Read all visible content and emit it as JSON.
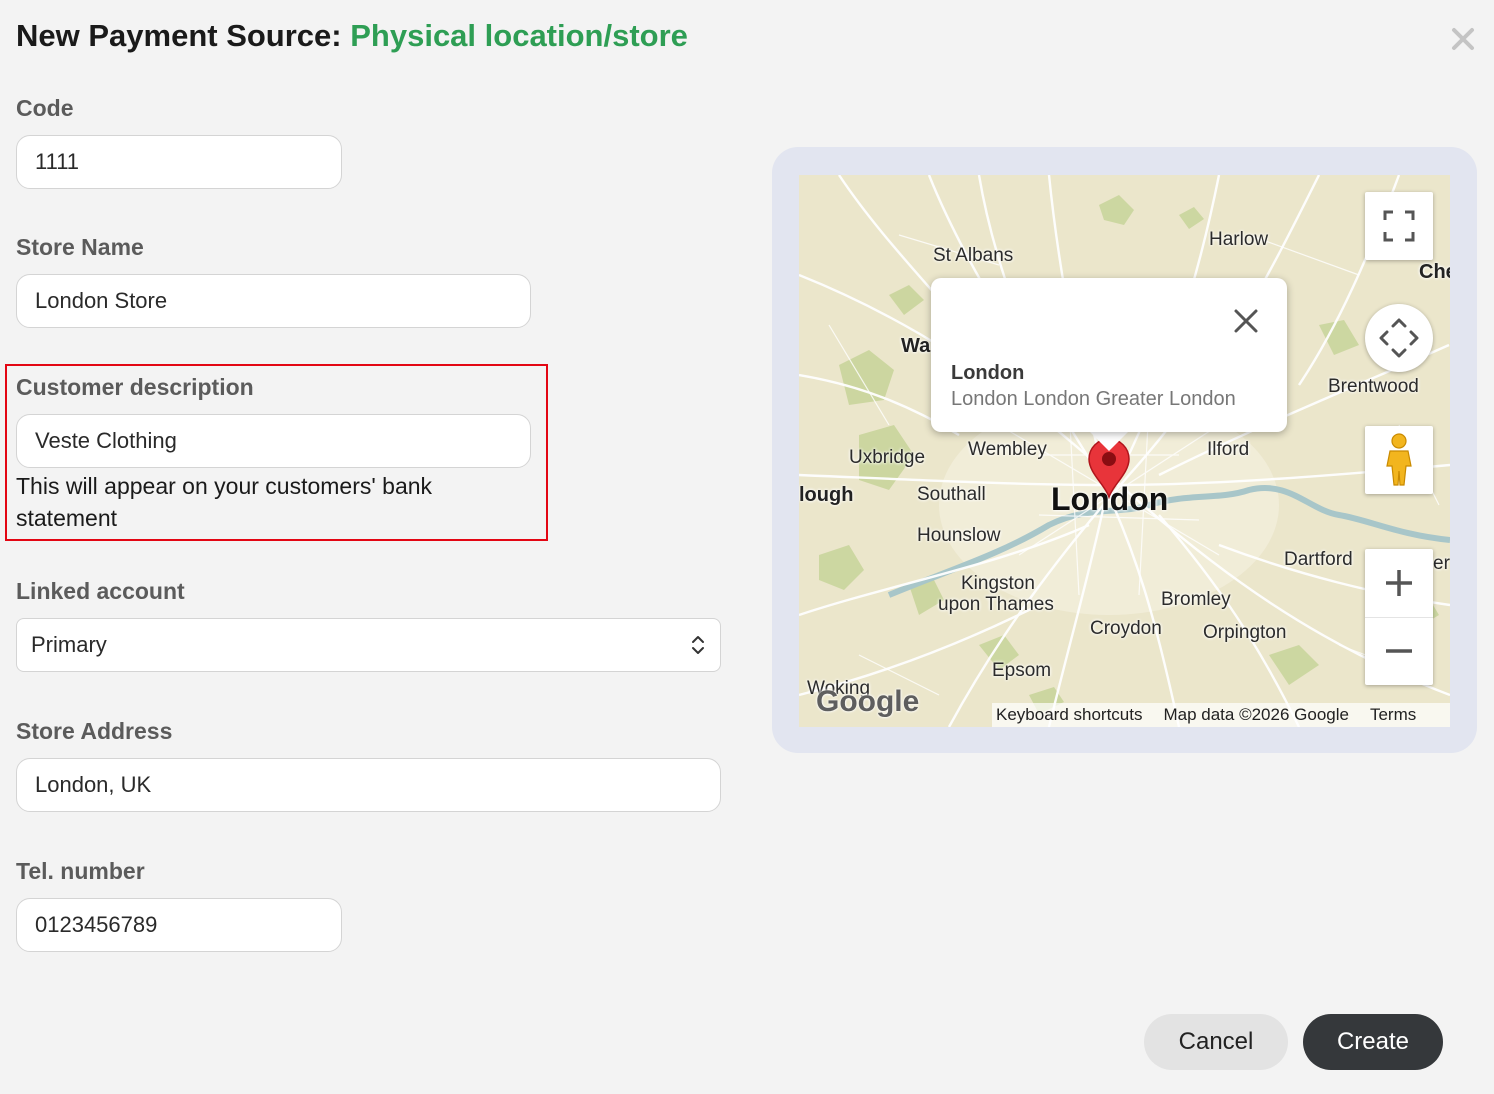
{
  "dialog": {
    "title_prefix": "New Payment Source:",
    "title_accent": "Physical location/store",
    "close_icon": "close-icon"
  },
  "form": {
    "code": {
      "label": "Code",
      "value": "1111"
    },
    "store_name": {
      "label": "Store Name",
      "value": "London Store"
    },
    "customer_description": {
      "label": "Customer description",
      "value": "Veste Clothing",
      "helper": "This will appear on your customers' bank statement"
    },
    "linked_account": {
      "label": "Linked account",
      "value": "Primary"
    },
    "store_address": {
      "label": "Store Address",
      "value": "London, UK"
    },
    "tel_number": {
      "label": "Tel. number",
      "value": "0123456789"
    }
  },
  "map": {
    "places": {
      "st_albans": "St Albans",
      "harlow": "Harlow",
      "che": "Che",
      "wa": "Wa",
      "brentwood": "Brentwood",
      "uxbridge": "Uxbridge",
      "wembley": "Wembley",
      "ilford": "Ilford",
      "slough": "lough",
      "southall": "Southall",
      "london": "London",
      "hounslow": "Hounslow",
      "dartford": "Dartford",
      "er": "er",
      "kingston_1": "Kingston",
      "kingston_2": "upon Thames",
      "bromley": "Bromley",
      "croydon": "Croydon",
      "orpington": "Orpington",
      "epsom": "Epsom",
      "woking": "Woking"
    },
    "popup": {
      "title": "London",
      "subtitle": "London London Greater London"
    },
    "attribution": {
      "keyboard": "Keyboard shortcuts",
      "data": "Map data ©2026 Google",
      "terms": "Terms"
    },
    "logo": "Google",
    "controls": [
      "fullscreen-icon",
      "camera-control-icon",
      "pegman-icon",
      "zoom-in-icon",
      "zoom-out-icon"
    ]
  },
  "footer": {
    "cancel_label": "Cancel",
    "create_label": "Create"
  },
  "colors": {
    "accent": "#2e9e54",
    "highlight": "#e30613",
    "create_bg": "#35383b",
    "map_bg": "#ebe6cb",
    "marker": "#e8343a"
  }
}
